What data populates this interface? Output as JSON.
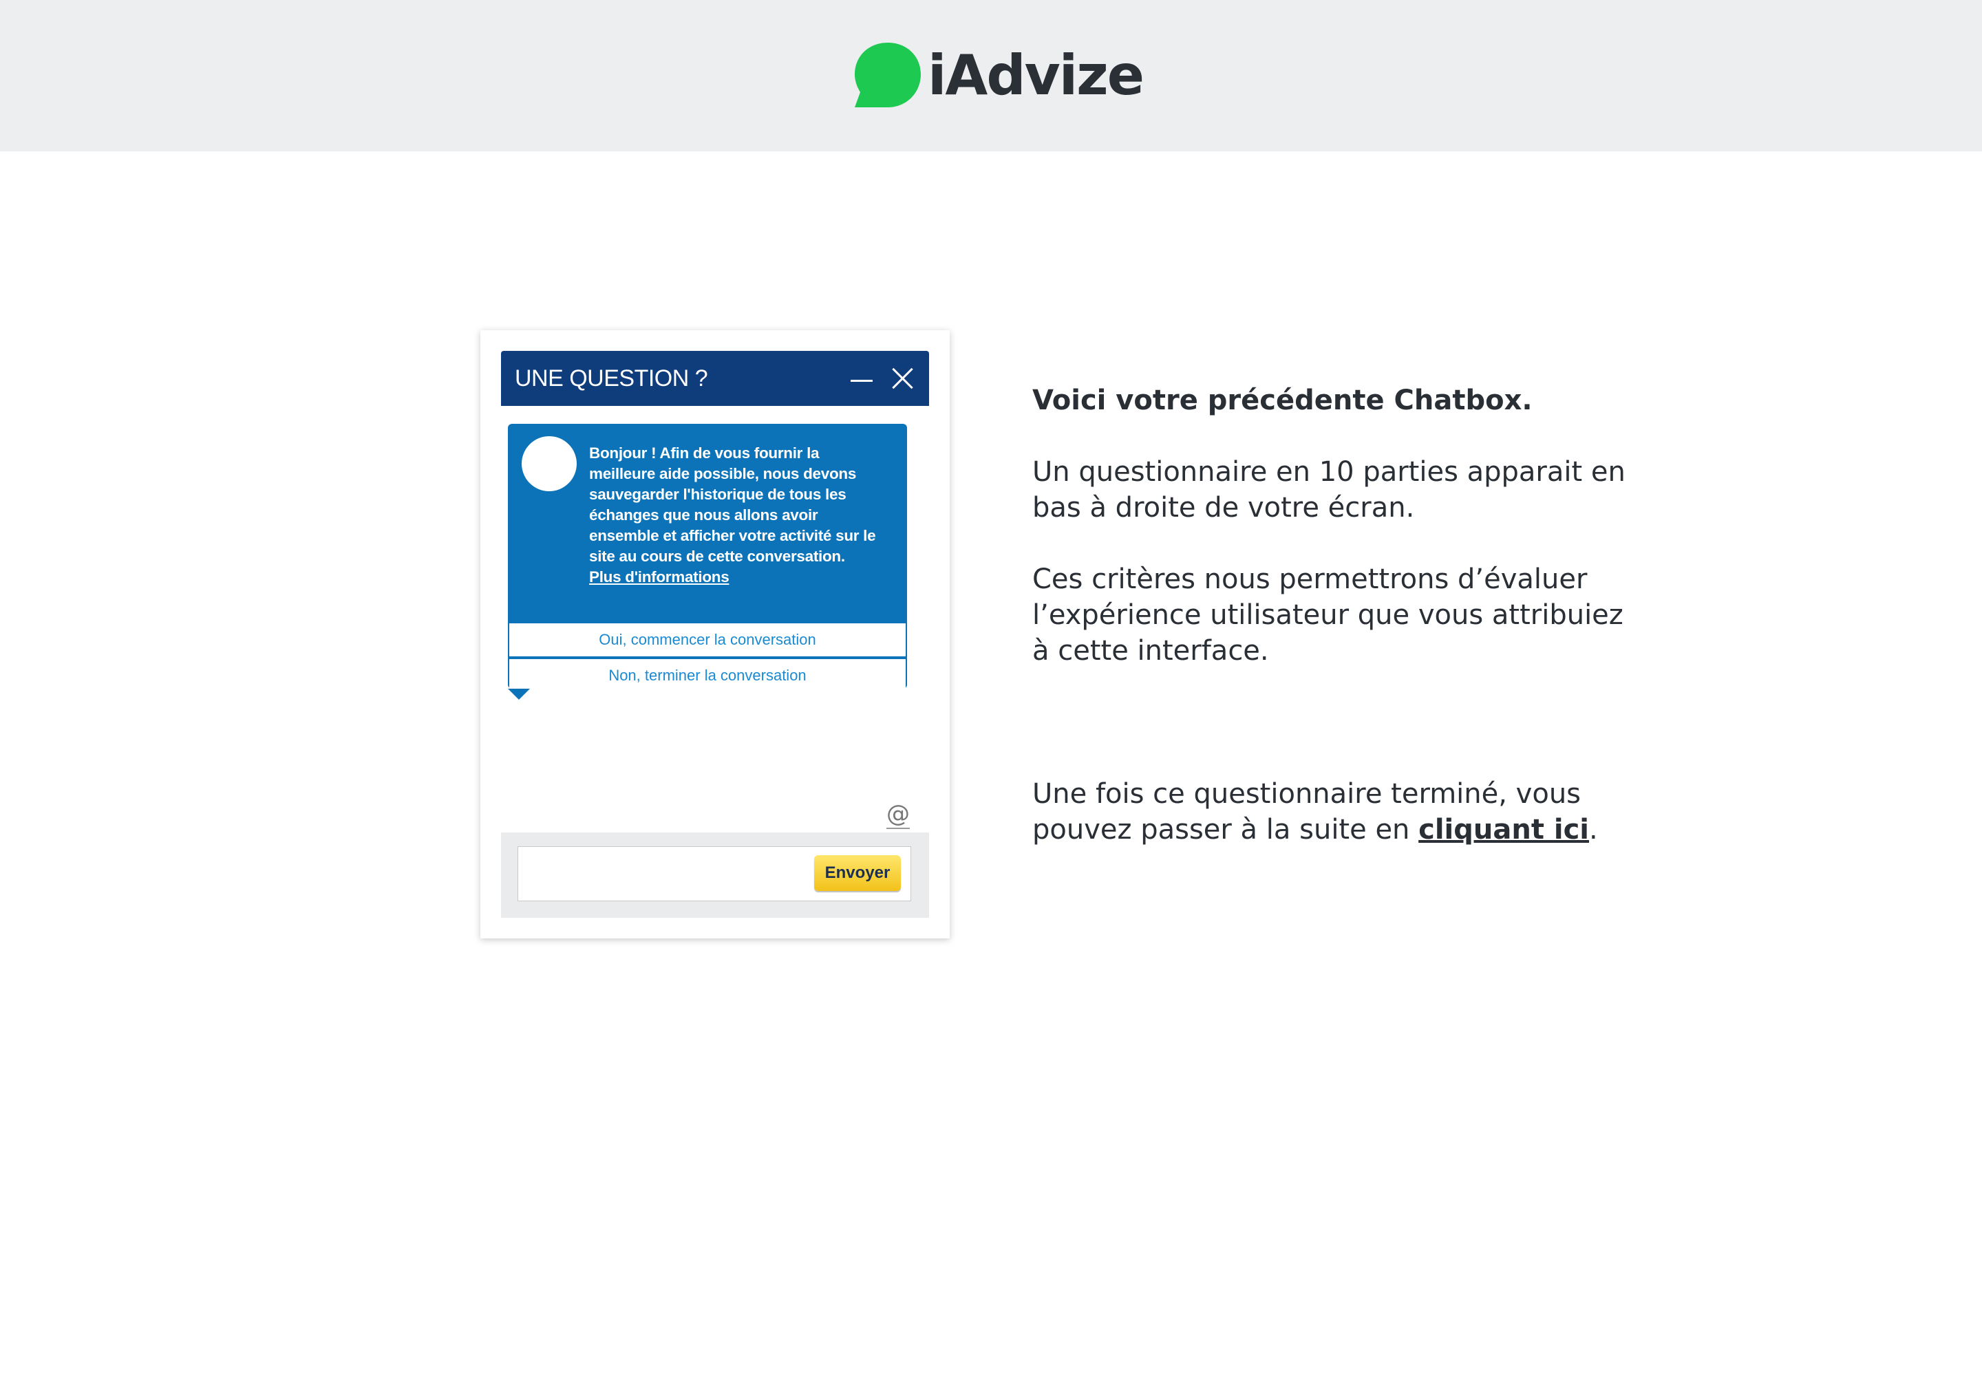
{
  "header": {
    "brand_name": "iAdvize",
    "brand_color": "#1ec951"
  },
  "chatbox": {
    "title": "UNE QUESTION ?",
    "minimize_icon": "minimize-icon",
    "close_icon": "close-icon",
    "message": "Bonjour ! Afin de vous fournir la meilleure aide possible, nous devons sauvegarder l'historique de tous les échanges que nous allons avoir ensemble et afficher votre activité sur le site au cours de cette conversation.",
    "more_info_link": "Plus d'informations",
    "option_yes": "Oui, commencer la conversation",
    "option_no": "Non, terminer la conversation",
    "email_icon": "@",
    "input_value": "",
    "send_label": "Envoyer",
    "header_color": "#0f3c7a",
    "bubble_color": "#0c73b8"
  },
  "info": {
    "title": "Voici votre précédente Chatbox.",
    "paragraph1": "Un questionnaire en 10 parties apparait en bas à droite de votre écran.",
    "paragraph2": "Ces critères nous permettrons d’évaluer l’expérience utilisateur que vous attribuiez à cette interface.",
    "paragraph3_before": "Une fois ce questionnaire terminé, vous pouvez passer à la suite en ",
    "link_text": "cliquant ici",
    "paragraph3_after": "."
  }
}
